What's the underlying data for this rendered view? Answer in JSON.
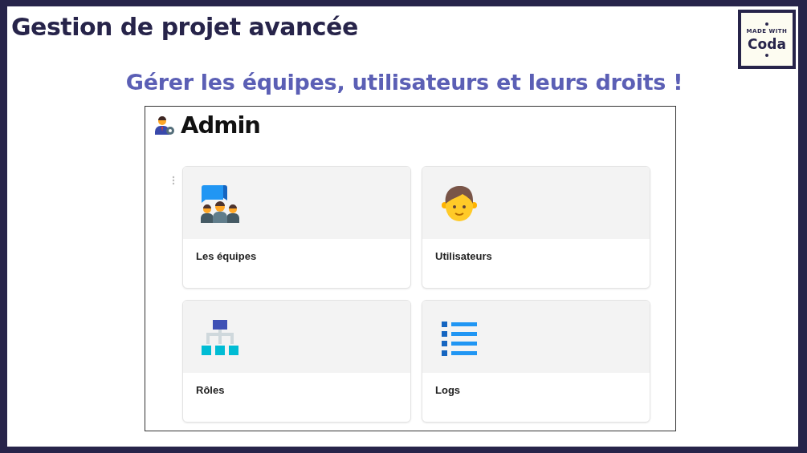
{
  "slide": {
    "title": "Gestion de projet avancée",
    "subtitle": "Gérer les équipes, utilisateurs et leurs droits !"
  },
  "badge": {
    "line_1": "MADE WITH",
    "line_2": "Coda"
  },
  "doc": {
    "heading": "Admin",
    "cards": [
      {
        "label": "Les équipes",
        "kind": "teams"
      },
      {
        "label": "Utilisateurs",
        "kind": "user"
      },
      {
        "label": "Rôles",
        "kind": "hierarchy"
      },
      {
        "label": "Logs",
        "kind": "list"
      }
    ]
  }
}
